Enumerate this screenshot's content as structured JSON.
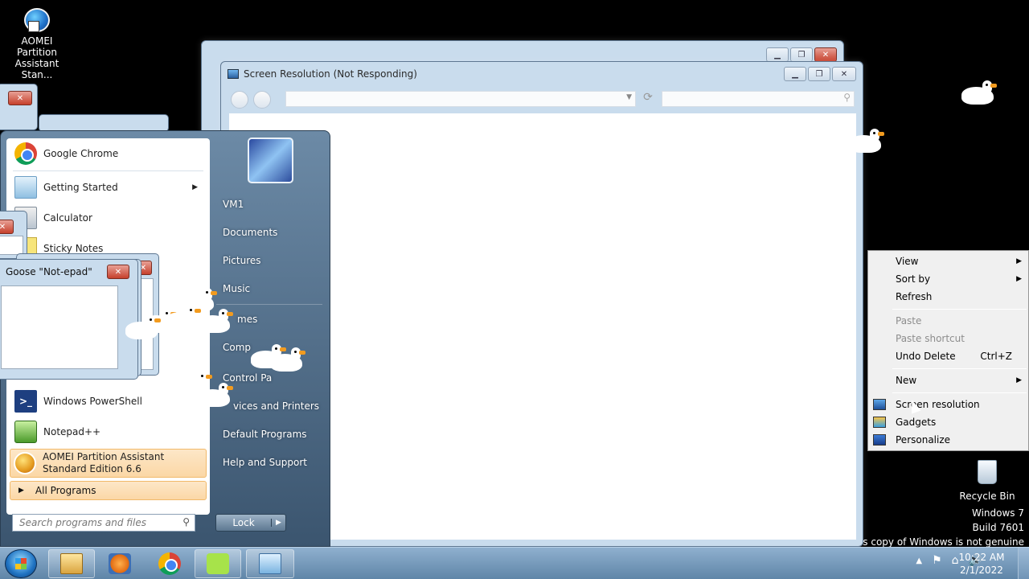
{
  "desktop": {
    "icons": [
      {
        "label": "AOMEI Partition Assistant Stan..."
      },
      {
        "label": "Recycle Bin"
      }
    ],
    "watermark": [
      "Windows 7",
      "Build 7601",
      "This copy of Windows is not genuine"
    ]
  },
  "windows": {
    "back_window": {
      "title": ""
    },
    "screen_resolution": {
      "title": "Screen Resolution (Not Responding)"
    },
    "goose_notepad": {
      "title": "Goose \"Not-epad\""
    }
  },
  "start_menu": {
    "pinned": [
      {
        "label": "Google Chrome",
        "icon": "chrome-icon"
      },
      {
        "label": "Getting Started",
        "icon": "getting-started-icon",
        "submenu": true
      },
      {
        "label": "Calculator",
        "icon": "calculator-icon"
      },
      {
        "label": "Sticky Notes",
        "icon": "sticky-notes-icon"
      },
      {
        "label": "Windows PowerShell",
        "icon": "powershell-icon"
      },
      {
        "label": "Notepad++",
        "icon": "notepadpp-icon"
      },
      {
        "label": "AOMEI Partition Assistant",
        "label2": "Standard Edition 6.6",
        "icon": "aomei-icon"
      }
    ],
    "all_programs": "All Programs",
    "search_placeholder": "Search programs and files",
    "right": [
      "VM1",
      "Documents",
      "Pictures",
      "Music",
      "Games",
      "Computer",
      "Control Panel",
      "Devices and Printers",
      "Default Programs",
      "Help and Support"
    ],
    "right_visible": [
      "VM1",
      "Documents",
      "Pictures",
      "Music",
      "mes",
      "Comp",
      "Control Pa",
      "vices and Printers",
      "Default Programs",
      "Help and Support"
    ],
    "lock_label": "Lock"
  },
  "context_menu": {
    "items": [
      {
        "label": "View",
        "submenu": true
      },
      {
        "label": "Sort by",
        "submenu": true
      },
      {
        "label": "Refresh"
      },
      {
        "label": "Paste",
        "disabled": true
      },
      {
        "label": "Paste shortcut",
        "disabled": true
      },
      {
        "label": "Undo Delete",
        "shortcut": "Ctrl+Z"
      },
      {
        "label": "New",
        "submenu": true
      },
      {
        "label": "Screen resolution",
        "icon": "screen-resolution-icon"
      },
      {
        "label": "Gadgets",
        "icon": "gadgets-icon"
      },
      {
        "label": "Personalize",
        "icon": "personalize-icon"
      }
    ]
  },
  "taskbar": {
    "clock_time": "10:22 AM",
    "clock_date": "2/1/2022",
    "buttons": [
      "explorer-icon",
      "media-player-icon",
      "chrome-icon",
      "goose-app-icon",
      "control-panel-icon"
    ]
  },
  "colors": {
    "desktop_bg": "#000000",
    "highlight": "#fbd7a6",
    "taskbar": "#6f93b5"
  }
}
